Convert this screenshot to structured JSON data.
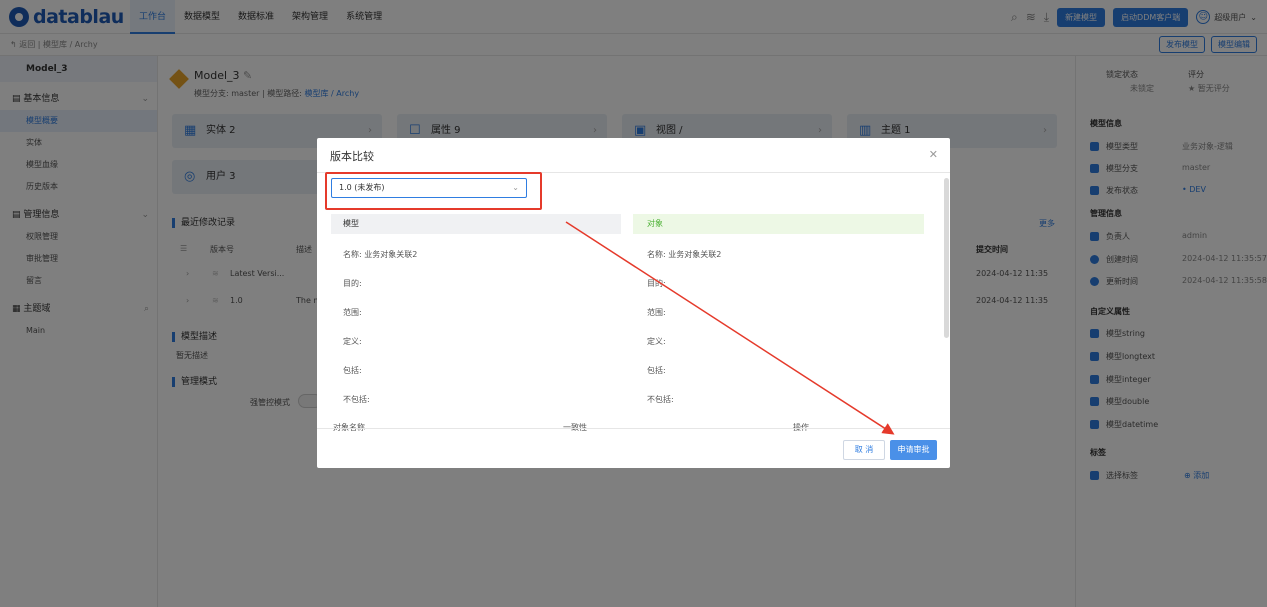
{
  "app": {
    "logo_text": "datablau"
  },
  "nav": [
    "工作台",
    "数据模型",
    "数据标准",
    "架构管理",
    "系统管理"
  ],
  "top_right": {
    "new_model": "新建模型",
    "launch_client": "启动DDM客户端",
    "user": "超级用户"
  },
  "breadcrumb": {
    "text": "↰ 返回 | 模型库 / Archy",
    "publish": "发布模型",
    "edit": "模型编辑"
  },
  "sidebar": {
    "model": "Model_3",
    "groups": [
      {
        "label": "基本信息",
        "items": [
          "模型概要",
          "实体",
          "模型血缘",
          "历史版本"
        ]
      },
      {
        "label": "管理信息",
        "items": [
          "权限管理",
          "审批管理",
          "留言"
        ]
      },
      {
        "label": "主题域",
        "items": [
          "Main"
        ]
      }
    ]
  },
  "main": {
    "title": "Model_3",
    "branch_label": "模型分支: master",
    "path_label": "模型路径:",
    "path_value": "模型库 / Archy",
    "cards": [
      {
        "icon": "▦",
        "label": "实体 2"
      },
      {
        "icon": "☐",
        "label": "属性 9"
      },
      {
        "icon": "▣",
        "label": "视图 /"
      },
      {
        "icon": "▥",
        "label": "主题 1"
      },
      {
        "icon": "◎",
        "label": "用户 3"
      }
    ],
    "recent_title": "最近修改记录",
    "more": "更多",
    "col_version": "版本号",
    "col_desc": "描述",
    "col_submit_time": "提交时间",
    "rows": [
      {
        "version": "Latest Versi...",
        "desc": "",
        "time": "2024-04-12 11:35"
      },
      {
        "version": "1.0",
        "desc": "The m",
        "time": "2024-04-12 11:35"
      }
    ],
    "desc_title": "模型描述",
    "desc_value": "暂无描述",
    "mode_title": "管理模式",
    "mode_label": "强管控模式"
  },
  "rightpanel": {
    "lock_label": "锁定状态",
    "lock_value": "未锁定",
    "rating_label": "评分",
    "rating_value": "暂无评分",
    "model_info": "模型信息",
    "items1": [
      {
        "label": "模型类型",
        "value": "业务对象-逻辑"
      },
      {
        "label": "模型分支",
        "value": "master"
      },
      {
        "label": "发布状态",
        "value": "• DEV"
      }
    ],
    "mgmt_info": "管理信息",
    "items2": [
      {
        "label": "负责人",
        "value": "admin"
      },
      {
        "label": "创建时间",
        "value": "2024-04-12 11:35:57"
      },
      {
        "label": "更新时间",
        "value": "2024-04-12 11:35:58"
      }
    ],
    "custom_title": "自定义属性",
    "custom": [
      "模型string",
      "模型longtext",
      "模型integer",
      "模型double",
      "模型datetime"
    ],
    "tag_title": "标签",
    "tag_select": "选择标签",
    "tag_add": "⊕ 添加"
  },
  "dialog": {
    "title": "版本比较",
    "version_select": "1.0 (未发布)",
    "left_head": "模型",
    "right_head": "对象",
    "left_fields": [
      "名称: 业务对象关联2",
      "目的:",
      "范围:",
      "定义:",
      "包括:",
      "不包括:"
    ],
    "right_fields": [
      "名称: 业务对象关联2",
      "目的:",
      "范围:",
      "定义:",
      "包括:",
      "不包括:"
    ],
    "table_peek": [
      "对象名称",
      "一致性",
      "操作"
    ],
    "cancel": "取 消",
    "submit": "申请审批"
  },
  "colors": {
    "accent": "#2f7de1",
    "annotation": "#e53a2b",
    "green": "#52b43b"
  }
}
